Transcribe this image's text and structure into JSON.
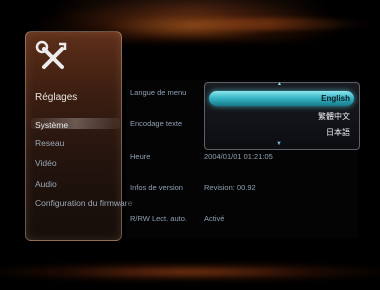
{
  "sidebar": {
    "icon": "tools-icon",
    "title": "Réglages",
    "items": [
      {
        "label": "Système",
        "active": true
      },
      {
        "label": "Reseau"
      },
      {
        "label": "Vidéo"
      },
      {
        "label": "Audio"
      },
      {
        "label": "Configuration du firmware"
      }
    ]
  },
  "settings": [
    {
      "label": "Langue de menu",
      "value": ""
    },
    {
      "label": "Encodage texte",
      "value": ""
    },
    {
      "label": "Heure",
      "value": "2004/01/01 01:21:05"
    },
    {
      "label": "Infos de version",
      "value": "Revision: 00.92"
    },
    {
      "label": "R/RW Lect. auto.",
      "value": "Activé"
    }
  ],
  "language_dropdown": {
    "options": [
      "English",
      "繁體中文",
      "日本語"
    ],
    "selected": "English",
    "accent_color": "#3ab8c8"
  }
}
